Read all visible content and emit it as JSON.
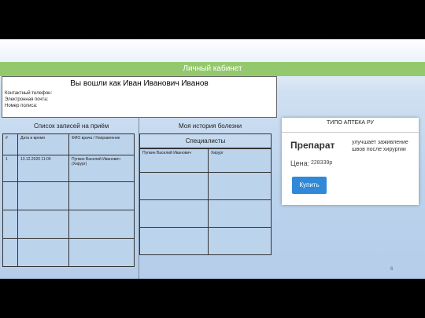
{
  "header": {
    "title": "Личный кабинет"
  },
  "profile": {
    "greeting": "Вы вошли как Иван Иванович Иванов",
    "phone_label": "Контактный телефон:",
    "email_label": "Электронная почта:",
    "policy_label": "Номер полиса:"
  },
  "appointments": {
    "title": "Список записей на приём",
    "columns": [
      "#",
      "Дата и время",
      "ФИО врача / Направление"
    ],
    "rows": [
      [
        "1",
        "13.12.2020 11:00",
        "Пупкин Василий Иванович (Хирург)"
      ]
    ]
  },
  "history": {
    "title": "Моя история болезни",
    "table_header": "Специалисты",
    "rows": [
      [
        "Пупкин Василий Иванович",
        "Хирург"
      ]
    ]
  },
  "pharmacy": {
    "title": "ТИПО АПТЕКА РУ",
    "product_name": "Препарат",
    "price_label": "Цена:",
    "price_value": "228339р",
    "description": "улучшает заживление швов после хирургии",
    "buy_label": "Купить"
  },
  "page_number": "6"
}
